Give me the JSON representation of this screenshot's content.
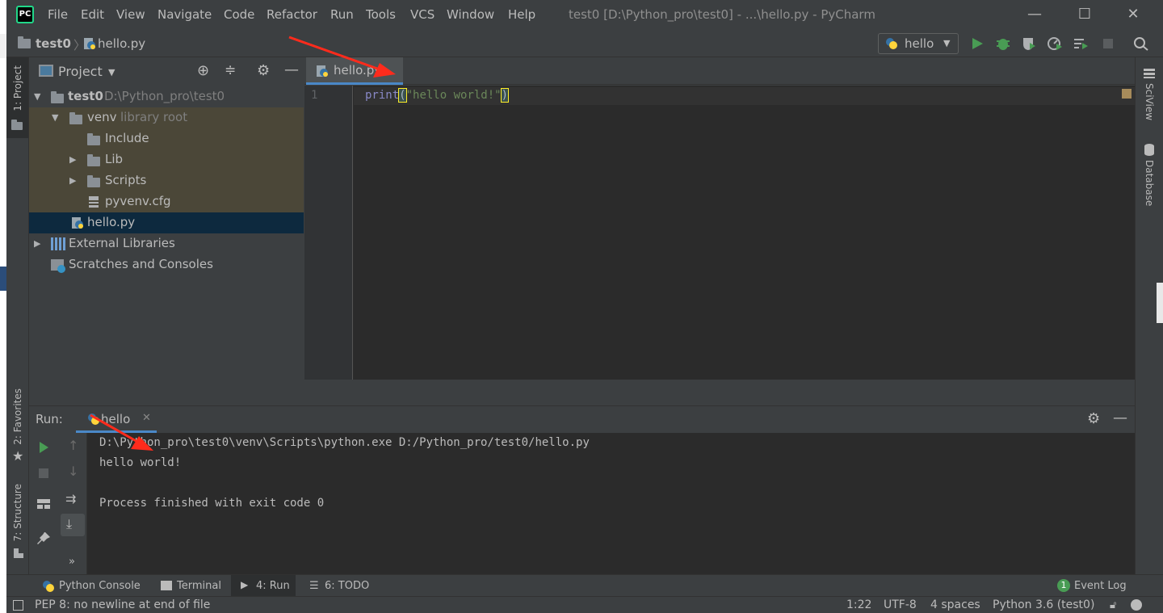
{
  "app": {
    "logo_text": "PC",
    "window_title": "test0 [D:\\Python_pro\\test0] - ...\\hello.py - PyCharm",
    "menu": [
      "File",
      "Edit",
      "View",
      "Navigate",
      "Code",
      "Refactor",
      "Run",
      "Tools",
      "VCS",
      "Window",
      "Help"
    ],
    "window_controls": {
      "minimize": "—",
      "maximize": "☐",
      "close": "✕"
    }
  },
  "navbar": {
    "breadcrumb_project": "test0",
    "breadcrumb_file": "hello.py",
    "run_config": "hello"
  },
  "left_stripe": {
    "project_tab": "1: Project",
    "favorites_tab": "2: Favorites",
    "structure_tab": "7: Structure"
  },
  "right_stripe": {
    "sciview_tab": "SciView",
    "database_tab": "Database"
  },
  "project_panel": {
    "title": "Project",
    "tree": {
      "root_name": "test0",
      "root_path": "D:\\Python_pro\\test0",
      "venv_name": "venv",
      "venv_hint": "library root",
      "include": "Include",
      "lib": "Lib",
      "scripts": "Scripts",
      "cfg": "pyvenv.cfg",
      "hello": "hello.py",
      "external": "External Libraries",
      "scratches": "Scratches and Consoles"
    }
  },
  "editor": {
    "tab_label": "hello.py",
    "line_number": "1",
    "code_func": "print",
    "code_open": "(",
    "code_string": "\"hello world!\"",
    "code_close": ")"
  },
  "run_panel": {
    "label": "Run:",
    "tab": "hello",
    "output": [
      "D:\\Python_pro\\test0\\venv\\Scripts\\python.exe D:/Python_pro/test0/hello.py",
      "hello world!",
      "",
      "Process finished with exit code 0"
    ]
  },
  "bottom_tabs": {
    "python_console": "Python Console",
    "terminal": "Terminal",
    "run": "4: Run",
    "todo": "6: TODO",
    "event_log": "Event Log",
    "event_count": "1"
  },
  "statusbar": {
    "message": "PEP 8: no newline at end of file",
    "position": "1:22",
    "encoding": "UTF-8",
    "indent": "4 spaces",
    "interpreter": "Python 3.6 (test0)"
  },
  "colors": {
    "background": "#3c3f41",
    "editor_bg": "#2b2b2b",
    "string": "#6a8759",
    "function": "#8888c6",
    "run_green": "#499c54",
    "selection": "#0d293e",
    "annotation_red": "#ff2b1c"
  }
}
